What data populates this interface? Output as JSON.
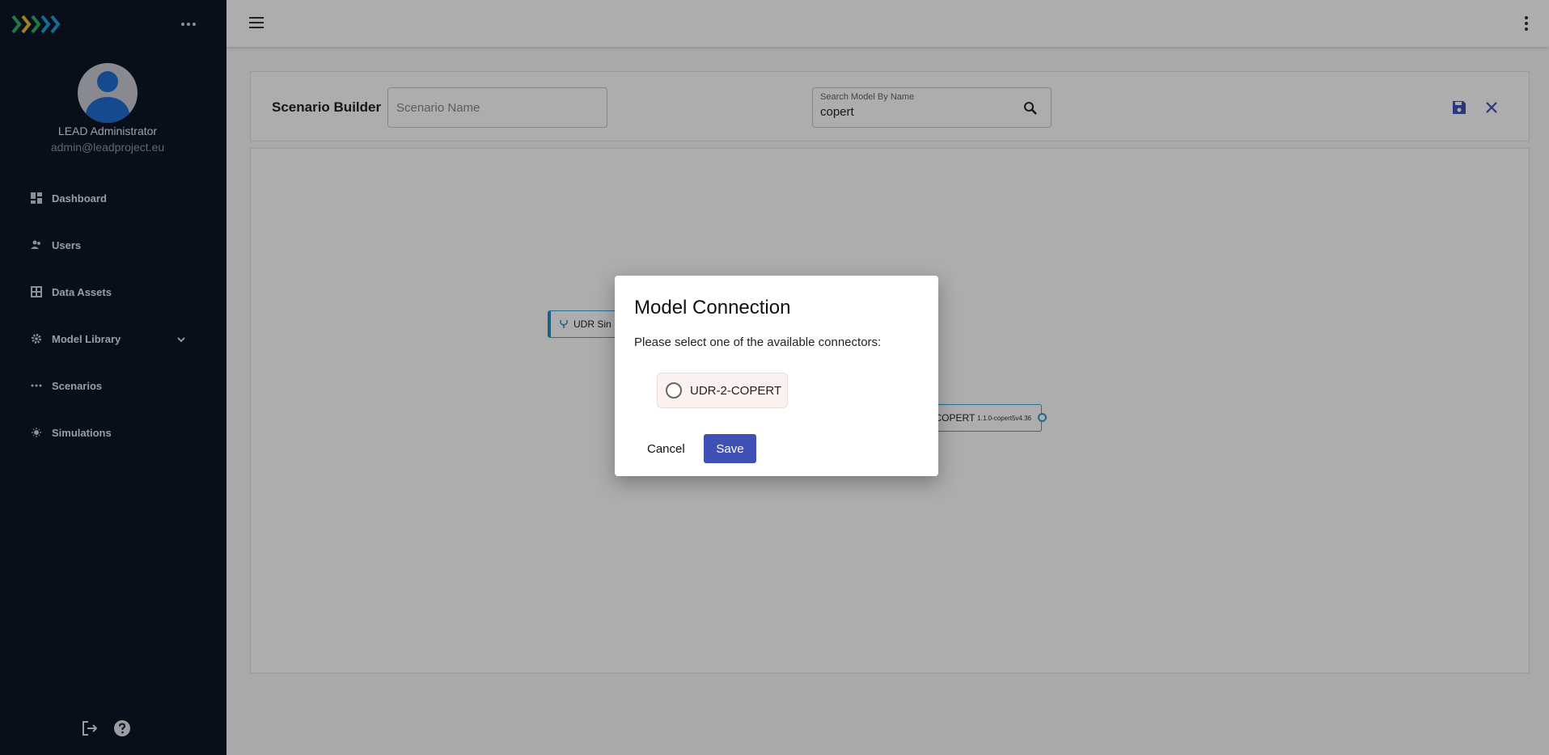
{
  "sidebar": {
    "user": {
      "name": "LEAD Administrator",
      "email": "admin@leadproject.eu"
    },
    "items": [
      {
        "label": "Dashboard",
        "icon": "dashboard-icon"
      },
      {
        "label": "Users",
        "icon": "users-icon"
      },
      {
        "label": "Data Assets",
        "icon": "data-assets-icon"
      },
      {
        "label": "Model Library",
        "icon": "gear-icon"
      },
      {
        "label": "Scenarios",
        "icon": "scenarios-icon"
      },
      {
        "label": "Simulations",
        "icon": "simulations-icon"
      }
    ]
  },
  "builder": {
    "title": "Scenario Builder",
    "scenario_name_placeholder": "Scenario Name",
    "search_label": "Search Model By Name",
    "search_value": "copert"
  },
  "canvas": {
    "nodes": [
      {
        "label": "UDR Sin"
      },
      {
        "label": "COPERT",
        "version": "1.1.0-copert5v4.36"
      }
    ]
  },
  "dialog": {
    "title": "Model Connection",
    "text": "Please select one of the available connectors:",
    "options": [
      {
        "label": "UDR-2-COPERT"
      }
    ],
    "cancel_label": "Cancel",
    "save_label": "Save"
  },
  "colors": {
    "sidebar_bg": "#0e1628",
    "primary": "#3f51b5",
    "node_accent": "#2a8fbd"
  }
}
